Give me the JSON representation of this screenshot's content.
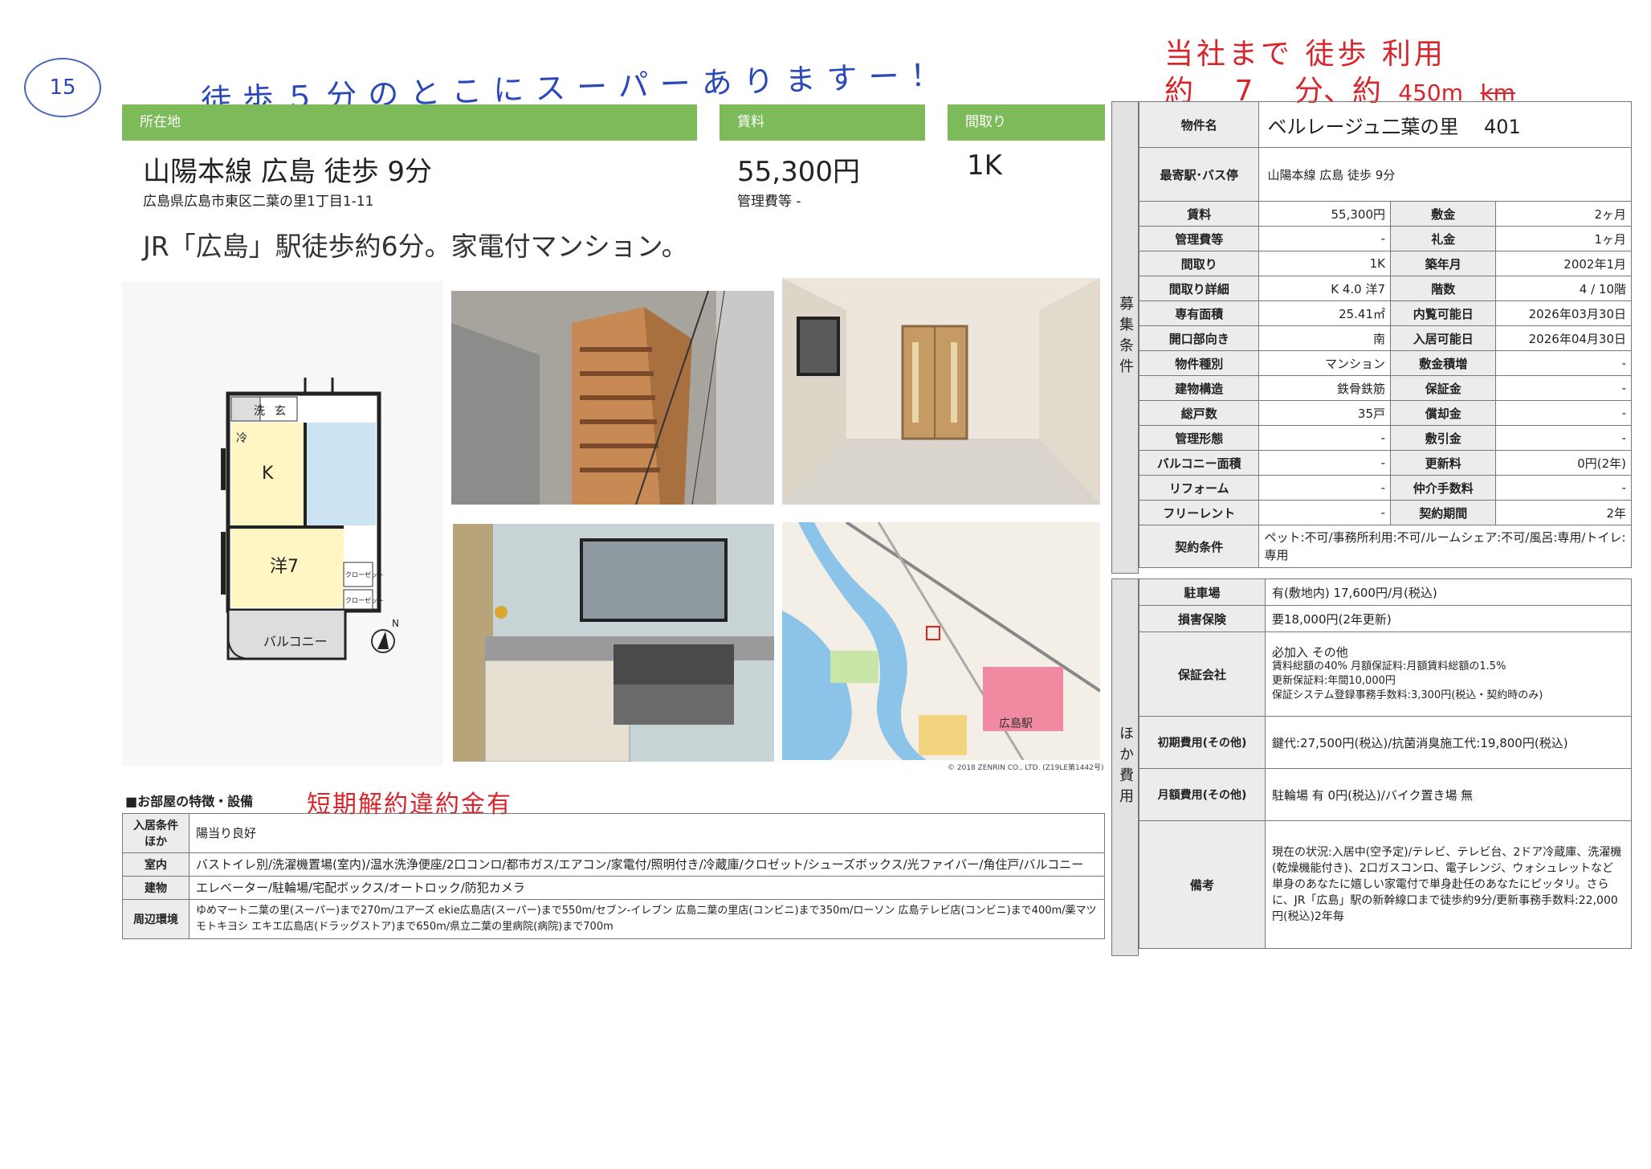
{
  "page_number": "15",
  "handwritten": {
    "note_top": "徒歩５分のとこにスーパーありますー！",
    "company_line1": "当社まで 徒歩 利用",
    "company_line2_label": "約",
    "company_minutes": "7",
    "company_line2_mid": "分、約",
    "company_distance": "450m",
    "company_unit_struck": "km",
    "short_term": "短期解約違約金有"
  },
  "header": {
    "location_label": "所在地",
    "rent_label": "賃料",
    "layout_label": "間取り",
    "station": "山陽本線 広島 徒歩 9分",
    "address": "広島県広島市東区二葉の里1丁目1-11",
    "rent": "55,300円",
    "mgmt_fee": "管理費等 -",
    "layout": "1K"
  },
  "catchphrase": "JR「広島」駅徒歩約6分。家電付マンション。",
  "floorplan": {
    "labels": [
      "洗",
      "玄",
      "冷",
      "K",
      "洋7",
      "クローゼット",
      "クローゼット",
      "バルコニー"
    ],
    "north": "N"
  },
  "map": {
    "credit": "© 2018 ZENRIN CO., LTD. (Z19LE第1442号)",
    "station_label": "広島駅"
  },
  "spec": {
    "property_name_label": "物件名",
    "property_name": "ベルレージュ二葉の里　 401",
    "nearest_label": "最寄駅･バス停",
    "nearest": "山陽本線 広島 徒歩 9分",
    "side_label": "募集条件",
    "rows": [
      [
        "賃料",
        "55,300円",
        "敷金",
        "2ヶ月"
      ],
      [
        "管理費等",
        "-",
        "礼金",
        "1ヶ月"
      ],
      [
        "間取り",
        "1K",
        "築年月",
        "2002年1月"
      ],
      [
        "間取り詳細",
        "K 4.0 洋7",
        "階数",
        "4 / 10階"
      ],
      [
        "専有面積",
        "25.41㎡",
        "内覧可能日",
        "2026年03月30日"
      ],
      [
        "開口部向き",
        "南",
        "入居可能日",
        "2026年04月30日"
      ],
      [
        "物件種別",
        "マンション",
        "敷金積増",
        "-"
      ],
      [
        "建物構造",
        "鉄骨鉄筋",
        "保証金",
        "-"
      ],
      [
        "総戸数",
        "35戸",
        "償却金",
        "-"
      ],
      [
        "管理形態",
        "-",
        "敷引金",
        "-"
      ],
      [
        "バルコニー面積",
        "-",
        "更新料",
        "0円(2年)"
      ],
      [
        "リフォーム",
        "-",
        "仲介手数料",
        "-"
      ],
      [
        "フリーレント",
        "-",
        "契約期間",
        "2年"
      ]
    ],
    "contract_label": "契約条件",
    "contract": "ペット:不可/事務所利用:不可/ルームシェア:不可/風呂:専用/トイレ:専用"
  },
  "other": {
    "side_label": "ほか費用",
    "parking_label": "駐車場",
    "parking": "有(敷地内) 17,600円/月(税込)",
    "insurance_label": "損害保険",
    "insurance": "要18,000円(2年更新)",
    "guarantor_label": "保証会社",
    "guarantor": [
      "必加入 その他",
      "賃料総額の40% 月額保証料:月額賃料総額の1.5%",
      "更新保証料:年間10,000円",
      "保証システム登録事務手数料:3,300円(税込・契約時のみ)"
    ],
    "initial_label": "初期費用(その他)",
    "initial": "鍵代:27,500円(税込)/抗菌消臭施工代:19,800円(税込)",
    "monthly_label": "月額費用(その他)",
    "monthly": "駐輪場 有 0円(税込)/バイク置き場 無",
    "remarks_label": "備考",
    "remarks": "現在の状況:入居中(空予定)/テレビ、テレビ台、2ドア冷蔵庫、洗濯機(乾燥機能付き)、2口ガスコンロ、電子レンジ、ウォシュレットなど単身のあなたに嬉しい家電付で単身赴任のあなたにピッタリ。さらに、JR「広島」駅の新幹線口まで徒歩約9分/更新事務手数料:22,000円(税込)2年毎"
  },
  "features": {
    "title": "■お部屋の特徴・設備",
    "rows": [
      [
        "入居条件ほか",
        "陽当り良好"
      ],
      [
        "室内",
        "バストイレ別/洗濯機置場(室内)/温水洗浄便座/2口コンロ/都市ガス/エアコン/家電付/照明付き/冷蔵庫/クロゼット/シューズボックス/光ファイバー/角住戸/バルコニー"
      ],
      [
        "建物",
        "エレベーター/駐輪場/宅配ボックス/オートロック/防犯カメラ"
      ],
      [
        "周辺環境",
        "ゆめマート二葉の里(スーパー)まで270m/ユアーズ ekie広島店(スーパー)まで550m/セブン-イレブン 広島二葉の里店(コンビニ)まで350m/ローソン 広島テレビ店(コンビニ)まで400m/薬マツモトキヨシ エキエ広島店(ドラッグストア)まで650m/県立二葉の里病院(病院)まで700m"
      ]
    ]
  }
}
